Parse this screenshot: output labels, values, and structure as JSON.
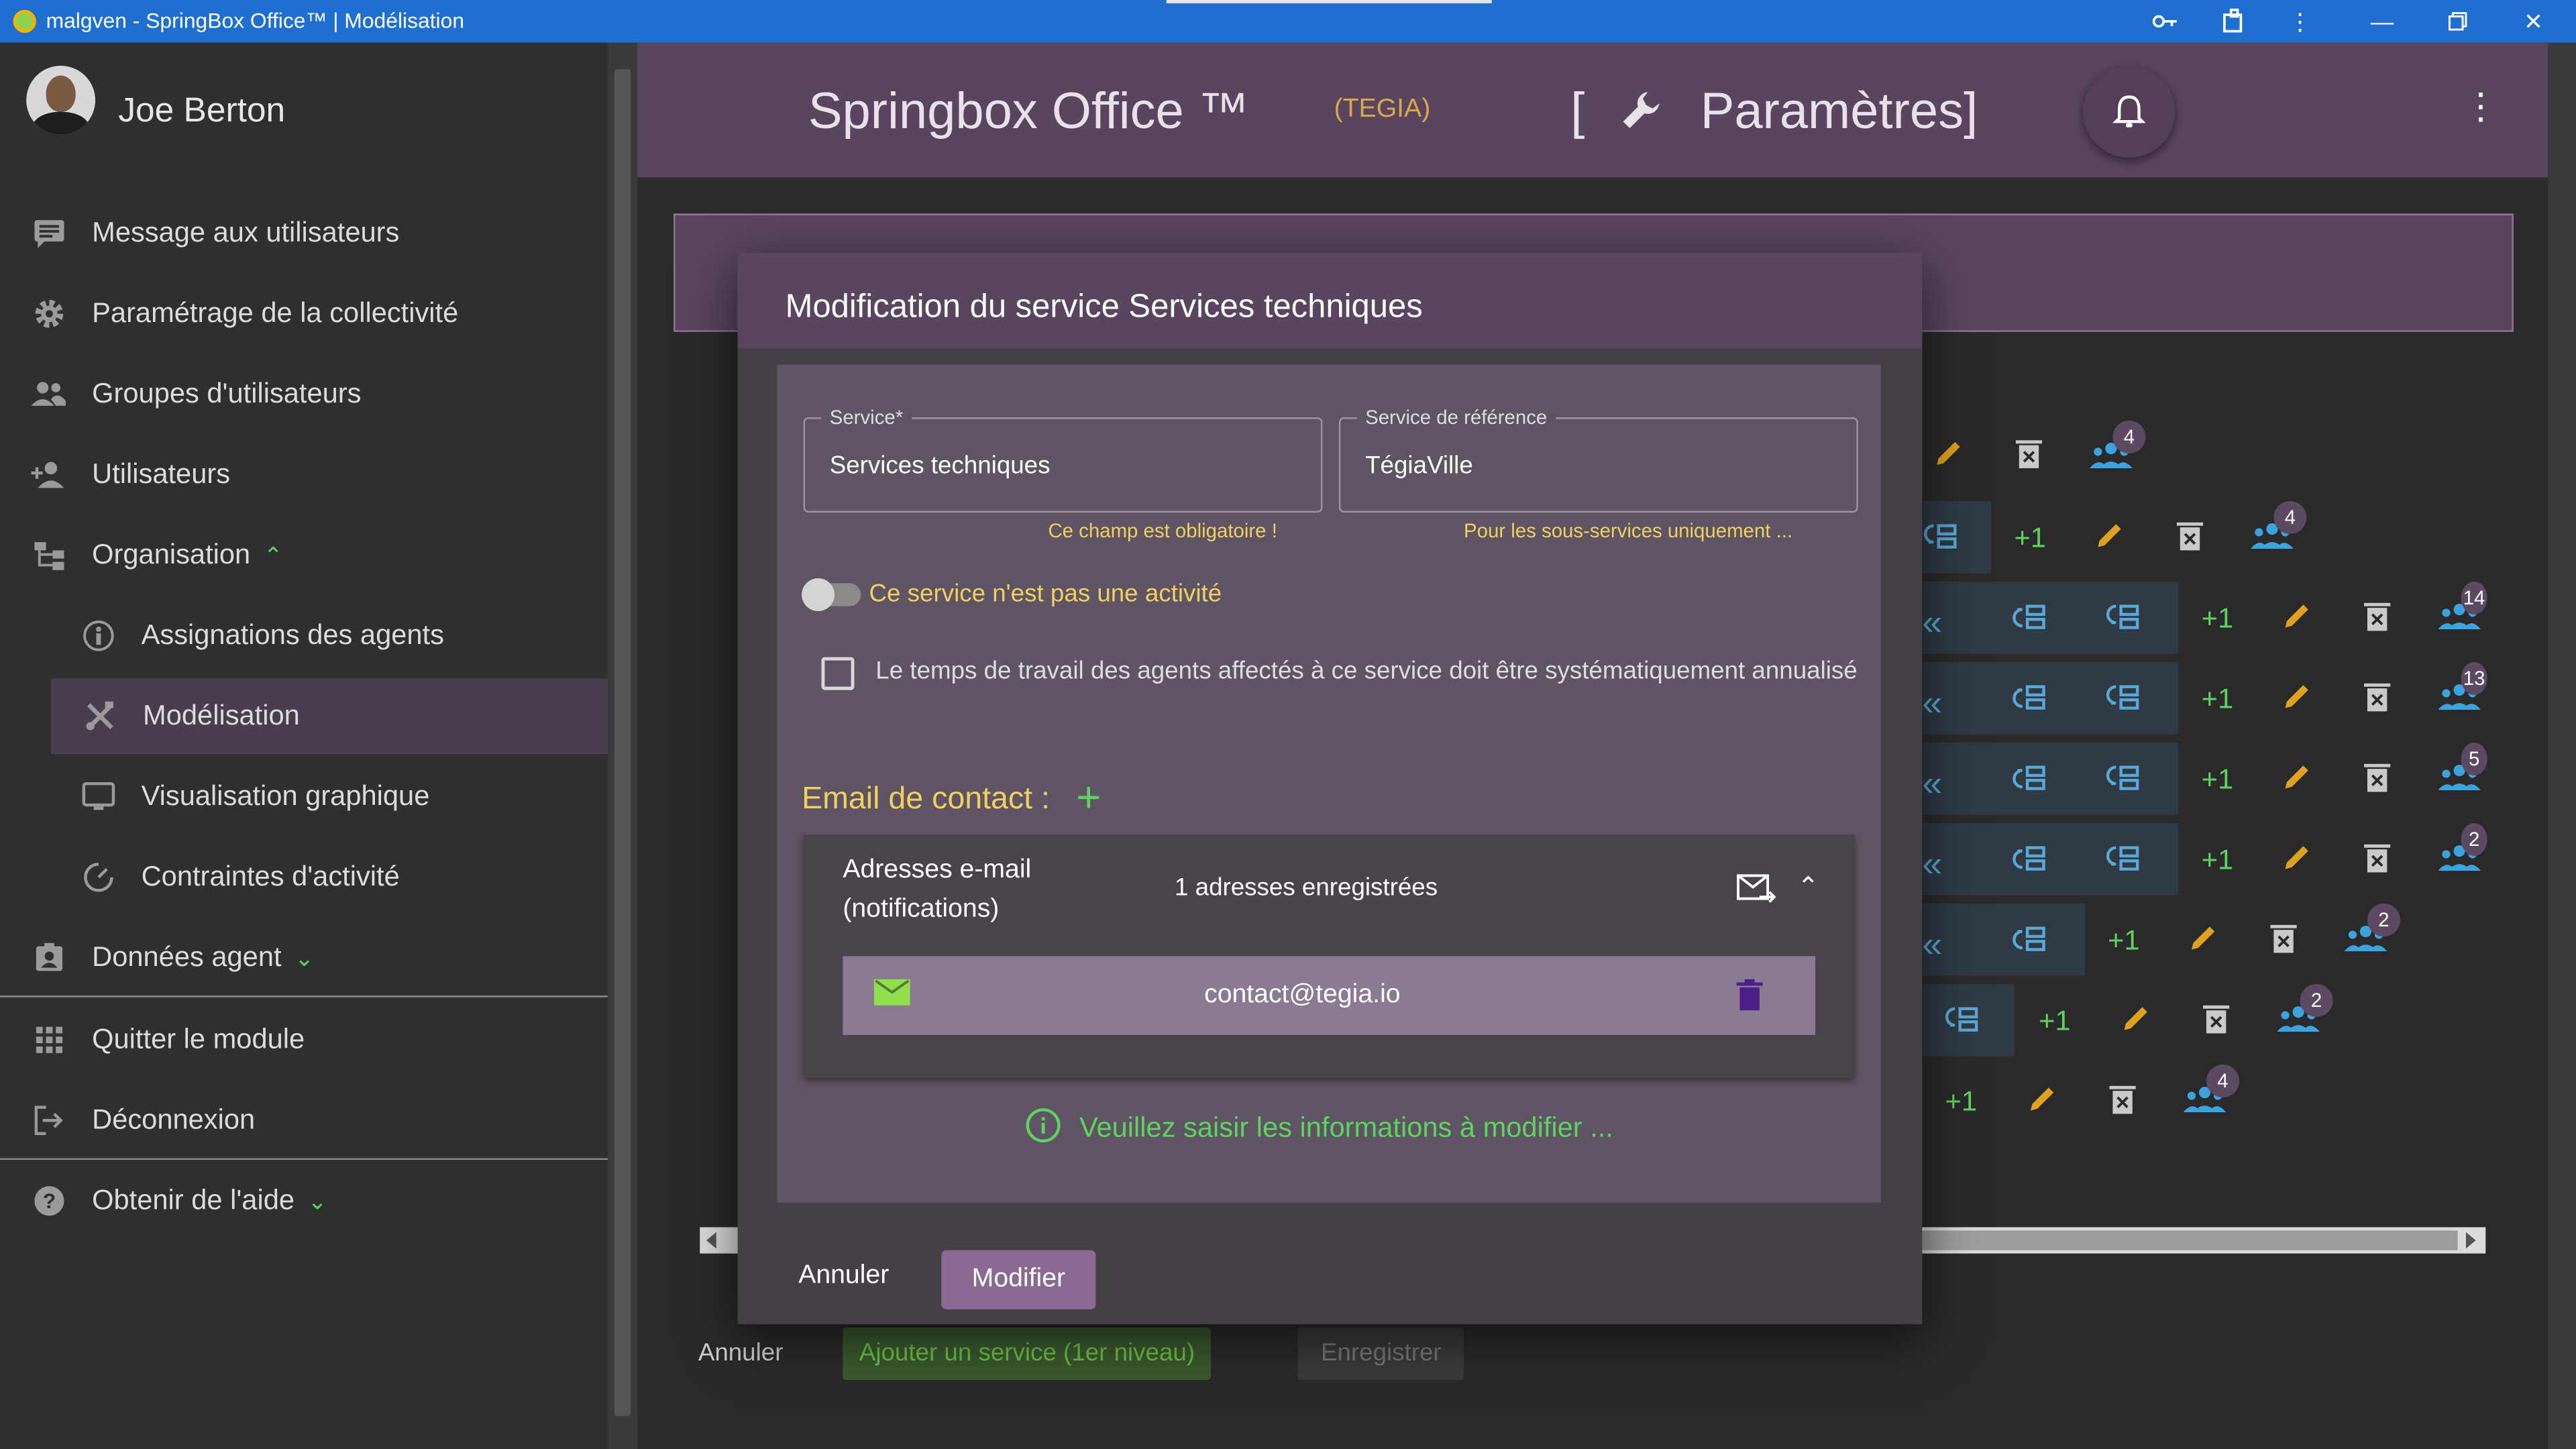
{
  "window": {
    "title": "malgven - SpringBox Office™ | Modélisation"
  },
  "user": {
    "name": "Joe Berton"
  },
  "sidebar": {
    "items": [
      {
        "label": "Message aux utilisateurs",
        "icon": "message-icon"
      },
      {
        "label": "Paramétrage de la collectivité",
        "icon": "gear-icon"
      },
      {
        "label": "Groupes d'utilisateurs",
        "icon": "users-group-icon"
      },
      {
        "label": "Utilisateurs",
        "icon": "user-add-icon"
      },
      {
        "label": "Organisation",
        "icon": "organisation-icon"
      },
      {
        "label": "Assignations des agents",
        "icon": "assign-icon"
      },
      {
        "label": "Modélisation",
        "icon": "tools-icon"
      },
      {
        "label": "Visualisation graphique",
        "icon": "monitor-icon"
      },
      {
        "label": "Contraintes d'activité",
        "icon": "timer-icon"
      },
      {
        "label": "Données agent",
        "icon": "badge-icon"
      },
      {
        "label": "Quitter le module",
        "icon": "apps-grid-icon"
      },
      {
        "label": "Déconnexion",
        "icon": "logout-icon"
      },
      {
        "label": "Obtenir de l'aide",
        "icon": "help-icon"
      }
    ]
  },
  "header": {
    "brand": "Springbox Office ™",
    "brand_sub": "(TEGIA)",
    "page_title_open": "[",
    "page_title": "Paramètres]"
  },
  "actions": {
    "plus_one": "+1",
    "badges": [
      "4",
      "4",
      "14",
      "13",
      "5",
      "2",
      "2",
      "2",
      "4"
    ]
  },
  "bottom_bar": {
    "cancel": "Annuler",
    "add_service": "Ajouter un service (1er niveau)",
    "save": "Enregistrer"
  },
  "modal": {
    "title": "Modification du service Services techniques",
    "service_label": "Service",
    "service_required": "*",
    "service_value": "Services techniques",
    "service_hint": "Ce champ est obligatoire !",
    "ref_label": "Service de référence",
    "ref_value": "TégiaVille",
    "ref_hint": "Pour les sous-services uniquement ...",
    "toggle_label": "Ce service n'est pas une activité",
    "checkbox_label": "Le temps de travail des agents affectés à ce service doit être systématiquement annualisé",
    "email_title": "Email de contact :",
    "email_add": "+",
    "email_panel_title": "Adresses e-mail (notifications)",
    "email_count": "1 adresses enregistrées",
    "email_address": "contact@tegia.io",
    "info": "Veuillez saisir les informations à modifier ...",
    "cancel": "Annuler",
    "submit": "Modifier"
  },
  "colors": {
    "titlebar": "#1f6fd1",
    "header": "#5a4560",
    "accent_green": "#5fd35f",
    "accent_yellow": "#f0d060"
  }
}
